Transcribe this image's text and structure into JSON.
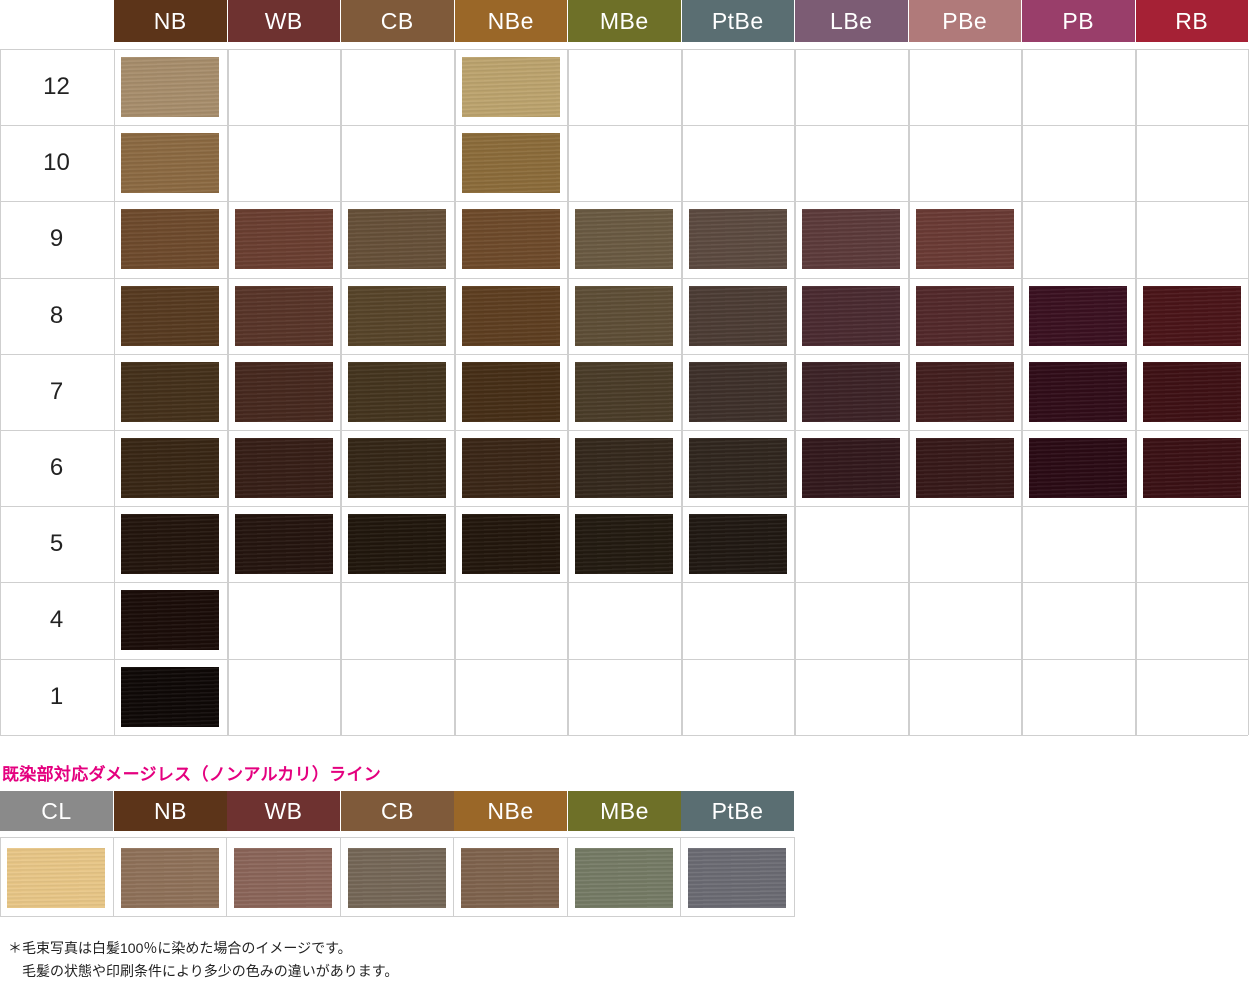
{
  "main_chart": {
    "columns": [
      {
        "label": "NB",
        "color": "#5c3419"
      },
      {
        "label": "WB",
        "color": "#6e3230"
      },
      {
        "label": "CB",
        "color": "#7f5a3a"
      },
      {
        "label": "NBe",
        "color": "#9a6728"
      },
      {
        "label": "MBe",
        "color": "#6e7028"
      },
      {
        "label": "PtBe",
        "color": "#5a6e72"
      },
      {
        "label": "LBe",
        "color": "#7c5c74"
      },
      {
        "label": "PBe",
        "color": "#b07a7a"
      },
      {
        "label": "PB",
        "color": "#993e6a"
      },
      {
        "label": "RB",
        "color": "#a52135"
      }
    ],
    "rows": [
      {
        "level": "12",
        "swatches": [
          "#a88e6c",
          null,
          null,
          "#bda46e",
          null,
          null,
          null,
          null,
          null,
          null
        ]
      },
      {
        "level": "10",
        "swatches": [
          "#8c6a42",
          null,
          null,
          "#8c6c3a",
          null,
          null,
          null,
          null,
          null,
          null
        ]
      },
      {
        "level": "9",
        "swatches": [
          "#6e4a2c",
          "#6a3e30",
          "#665038",
          "#6e4a2a",
          "#6a5a42",
          "#5c4a40",
          "#5c3a3a",
          "#6a3a34",
          null,
          null
        ]
      },
      {
        "level": "8",
        "swatches": [
          "#573a20",
          "#583428",
          "#574429",
          "#5e3e20",
          "#5e4e36",
          "#4c3c34",
          "#4a2a30",
          "#52282a",
          "#3a1020",
          "#4a1418"
        ]
      },
      {
        "level": "7",
        "swatches": [
          "#44301a",
          "#46281e",
          "#44341e",
          "#462e16",
          "#4a3c28",
          "#3e302a",
          "#3c2226",
          "#421e1e",
          "#300c18",
          "#3e1014"
        ]
      },
      {
        "level": "6",
        "swatches": [
          "#382614",
          "#361e16",
          "#342616",
          "#3a2616",
          "#34281c",
          "#30261e",
          "#32181c",
          "#361818",
          "#2a0a14",
          "#3a1014"
        ]
      },
      {
        "level": "5",
        "swatches": [
          "#22140c",
          "#24140e",
          "#20160c",
          "#22160c",
          "#221a10",
          "#201812",
          null,
          null,
          null,
          null
        ]
      },
      {
        "level": "4",
        "swatches": [
          "#1a0c08",
          null,
          null,
          null,
          null,
          null,
          null,
          null,
          null,
          null
        ]
      },
      {
        "level": "1",
        "swatches": [
          "#0e0806",
          null,
          null,
          null,
          null,
          null,
          null,
          null,
          null,
          null
        ]
      }
    ]
  },
  "line": {
    "title": "既染部対応ダメージレス（ノンアルカリ）ライン",
    "title_color": "#e4007f",
    "columns": [
      {
        "label": "CL",
        "color": "#8a8a8a",
        "swatch": "#e8c686"
      },
      {
        "label": "NB",
        "color": "#5c3419",
        "swatch": "#8e7058"
      },
      {
        "label": "WB",
        "color": "#6e3230",
        "swatch": "#8a6458"
      },
      {
        "label": "CB",
        "color": "#7f5a3a",
        "swatch": "#746656"
      },
      {
        "label": "NBe",
        "color": "#9a6728",
        "swatch": "#7e624c"
      },
      {
        "label": "MBe",
        "color": "#6e7028",
        "swatch": "#747a64"
      },
      {
        "label": "PtBe",
        "color": "#5a6e72",
        "swatch": "#6a6a72"
      }
    ]
  },
  "notes": {
    "line1": "＊毛束写真は白髪100％に染めた場合のイメージです。",
    "line2": "　毛髪の状態や印刷条件により多少の色みの違いがあります。"
  }
}
